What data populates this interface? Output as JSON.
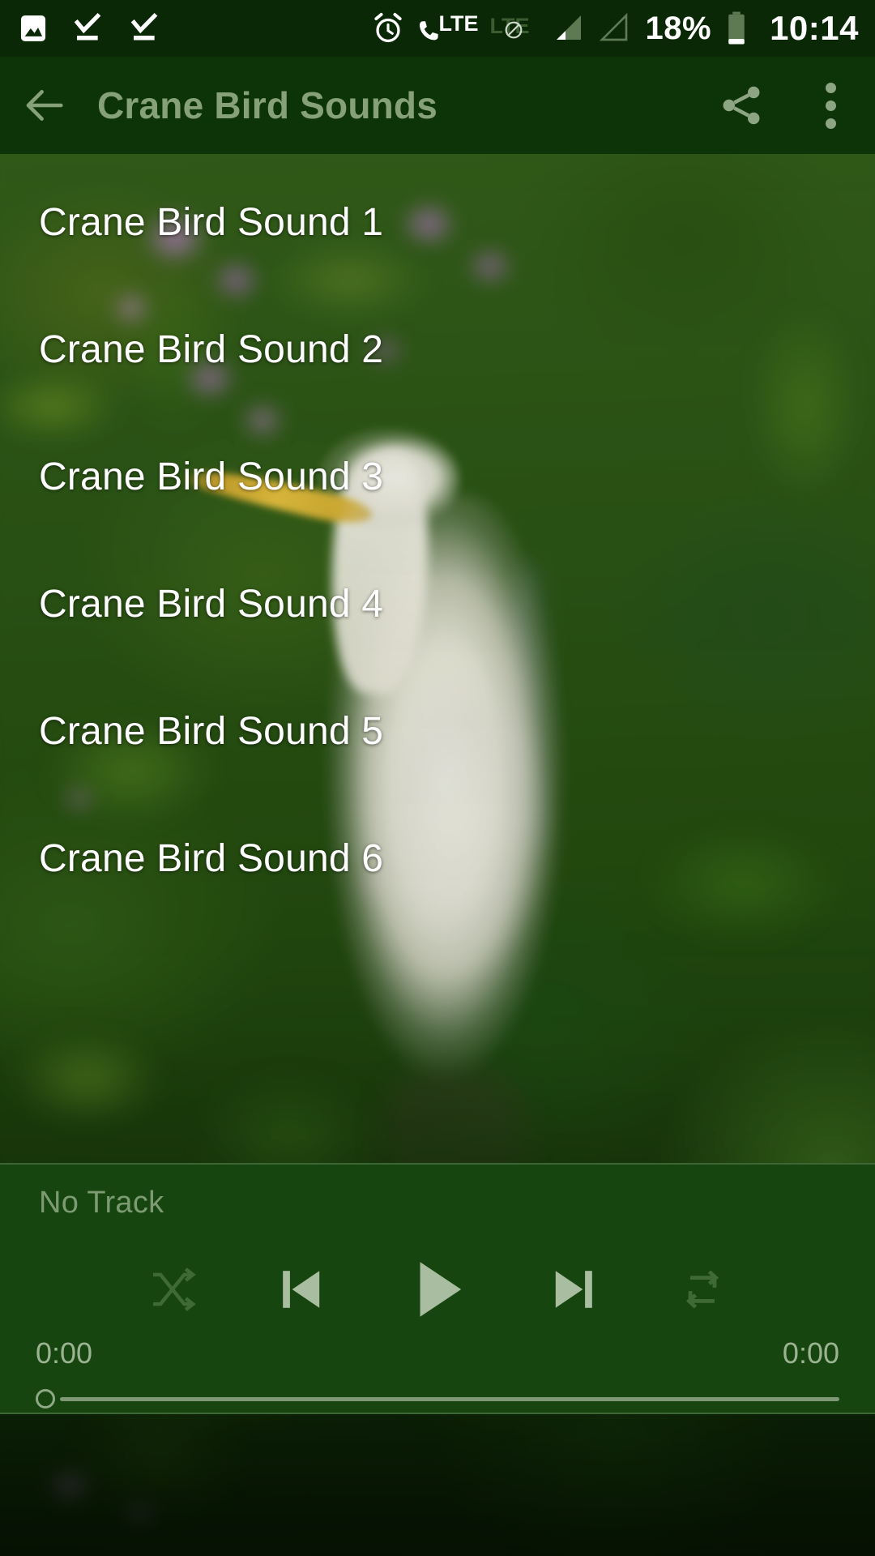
{
  "status_bar": {
    "left_icons": [
      {
        "name": "image-icon",
        "label": "Image"
      },
      {
        "name": "download-complete-icon",
        "label": "Download complete"
      },
      {
        "name": "download-complete-icon-2",
        "label": "Download complete"
      }
    ],
    "right_icons": [
      {
        "name": "alarm-icon",
        "label": "Alarm set"
      },
      {
        "name": "lte-call-icon",
        "label": "LTE"
      },
      {
        "name": "lte-disabled-icon",
        "label": "LTE"
      },
      {
        "name": "signal-bars-sim1-icon",
        "label": "Signal 1 bar"
      },
      {
        "name": "signal-bars-sim2-icon",
        "label": "No signal"
      }
    ],
    "battery_percent": "18%",
    "clock": "10:14"
  },
  "app_bar": {
    "back_label": "Back",
    "title": "Crane Bird Sounds",
    "share_label": "Share",
    "overflow_label": "More options"
  },
  "sound_list": {
    "items": [
      {
        "label": "Crane Bird Sound 1"
      },
      {
        "label": "Crane Bird Sound 2"
      },
      {
        "label": "Crane Bird Sound 3"
      },
      {
        "label": "Crane Bird Sound 4"
      },
      {
        "label": "Crane Bird Sound 5"
      },
      {
        "label": "Crane Bird Sound 6"
      }
    ]
  },
  "player": {
    "track_title": "No Track",
    "shuffle_label": "Shuffle",
    "previous_label": "Previous",
    "play_label": "Play",
    "next_label": "Next",
    "repeat_label": "Repeat",
    "current_time": "0:00",
    "total_time": "0:00",
    "progress_percent": 0
  },
  "colors": {
    "status_bar_bg": "#0a2706",
    "app_bar_bg": "#0d3309",
    "player_bg": "#16450f",
    "title_text": "#86a178",
    "list_text": "#ffffff",
    "control_active": "#a9bda1",
    "control_dim": "#3f6a35"
  }
}
